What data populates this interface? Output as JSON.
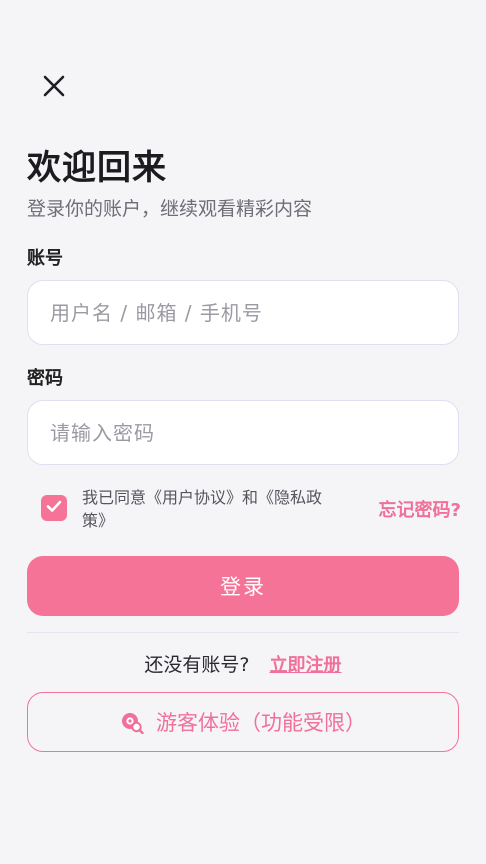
{
  "header": {
    "title": "欢迎回来",
    "subtitle": "登录你的账户，继续观看精彩内容"
  },
  "account": {
    "label": "账号",
    "placeholder": "用户名 / 邮箱 / 手机号",
    "value": ""
  },
  "password": {
    "label": "密码",
    "placeholder": "请输入密码",
    "value": ""
  },
  "agreement": {
    "checked": true,
    "text": "我已同意《用户协议》和《隐私政策》"
  },
  "forgot_label": "忘记密码?",
  "login_label": "登录",
  "register": {
    "prompt": "还没有账号?",
    "link": "立即注册"
  },
  "guest_label": "游客体验（功能受限）",
  "icons": {
    "close": "close-icon",
    "check": "check-icon",
    "guest": "search-eye-icon"
  },
  "colors": {
    "accent": "#f47397",
    "background": "#f5f4f6"
  }
}
